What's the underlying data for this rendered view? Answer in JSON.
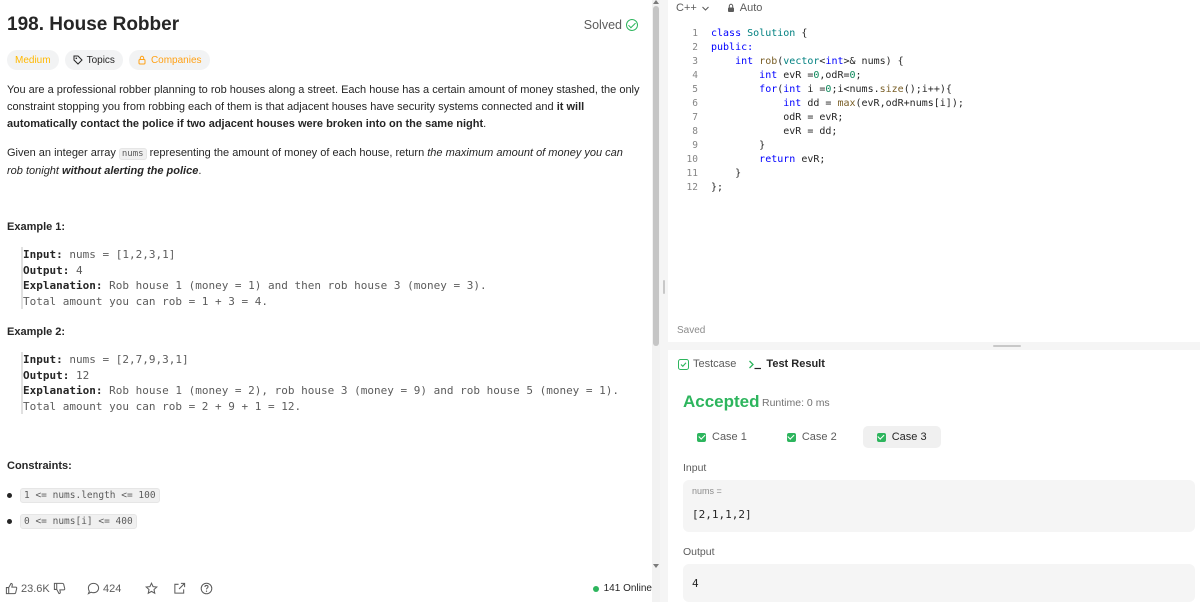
{
  "problem": {
    "title": "198. House Robber",
    "status": "Solved",
    "tags": {
      "difficulty": "Medium",
      "topics": "Topics",
      "companies": "Companies"
    },
    "desc1_a": "You are a professional robber planning to rob houses along a street. Each house has a certain amount of money stashed, the only",
    "desc1_b": "constraint stopping you from robbing each of them is that adjacent houses have security systems connected and ",
    "desc1_bold": "it will",
    "desc1_c": "automatically contact the police if two adjacent houses were broken into on the same night",
    "desc1_end": ".",
    "desc2_a": "Given an integer array ",
    "desc2_code": "nums",
    "desc2_b": " representing the amount of money of each house, return ",
    "desc2_italic": "the maximum amount of money you can",
    "desc2_italic2": "rob tonight ",
    "desc2_bold": "without alerting the police",
    "desc2_end": ".",
    "examples": [
      {
        "title": "Example 1:",
        "input_label": "Input:",
        "input": " nums = [1,2,3,1]",
        "output_label": "Output:",
        "output": " 4",
        "expl_label": "Explanation:",
        "expl": " Rob house 1 (money = 1) and then rob house 3 (money = 3).",
        "expl2": "Total amount you can rob = 1 + 3 = 4."
      },
      {
        "title": "Example 2:",
        "input_label": "Input:",
        "input": " nums = [2,7,9,3,1]",
        "output_label": "Output:",
        "output": " 12",
        "expl_label": "Explanation:",
        "expl": " Rob house 1 (money = 2), rob house 3 (money = 9) and rob house 5 (money = 1).",
        "expl2": "Total amount you can rob = 2 + 9 + 1 = 12."
      }
    ],
    "constraints_title": "Constraints:",
    "constraints": [
      "1 <= nums.length <= 100",
      "0 <= nums[i] <= 400"
    ]
  },
  "footer": {
    "likes": "23.6K",
    "comments": "424",
    "online": "141 Online"
  },
  "editor": {
    "language": "C++",
    "mode": "Auto",
    "saved": "Saved",
    "lines": [
      {
        "n": "1",
        "t": "class Solution {"
      },
      {
        "n": "2",
        "t": "public:"
      },
      {
        "n": "3",
        "t": "    int rob(vector<int>& nums) {"
      },
      {
        "n": "4",
        "t": "        int evR =0,odR=0;"
      },
      {
        "n": "5",
        "t": "        for(int i =0;i<nums.size();i++){"
      },
      {
        "n": "6",
        "t": "            int dd = max(evR,odR+nums[i]);"
      },
      {
        "n": "7",
        "t": "            odR = evR;"
      },
      {
        "n": "8",
        "t": "            evR = dd;"
      },
      {
        "n": "9",
        "t": "        }"
      },
      {
        "n": "10",
        "t": "        return evR;"
      },
      {
        "n": "11",
        "t": "    }"
      },
      {
        "n": "12",
        "t": "};"
      }
    ]
  },
  "result": {
    "tab_testcase": "Testcase",
    "tab_result": "Test Result",
    "verdict": "Accepted",
    "runtime": "Runtime: 0 ms",
    "cases": [
      "Case 1",
      "Case 2",
      "Case 3"
    ],
    "input_label": "Input",
    "var_name": "nums =",
    "var_value": "[2,1,1,2]",
    "output_label": "Output",
    "output_value": "4"
  },
  "colors": {
    "accent_green": "#2db55d",
    "medium": "#ffb800",
    "companies": "#ffa116"
  }
}
